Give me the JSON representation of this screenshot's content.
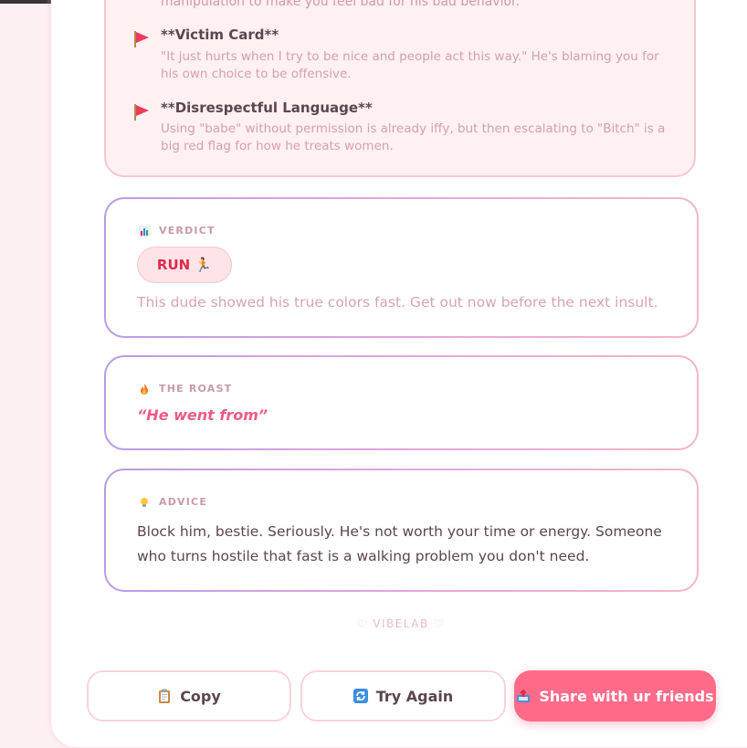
{
  "flags_section": {
    "cut_text": "manipulation to make you feel bad for his bad behavior.",
    "items": [
      {
        "title": "**Victim Card**",
        "description": "\"It just hurts when I try to be nice and people act this way.\" He's blaming you for his own choice to be offensive.",
        "icon": "red-flag-icon"
      },
      {
        "title": "**Disrespectful Language**",
        "description": "Using \"babe\" without permission is already iffy, but then escalating to \"Bitch\" is a big red flag for how he treats women.",
        "icon": "red-flag-icon"
      }
    ]
  },
  "verdict": {
    "label": "VERDICT",
    "icon": "bar-chart-icon",
    "pill": "RUN 🏃",
    "text": "This dude showed his true colors fast. Get out now before the next insult."
  },
  "roast": {
    "label": "THE ROAST",
    "icon": "fire-icon",
    "text": "“He went from”"
  },
  "advice": {
    "label": "ADVICE",
    "icon": "lightbulb-icon",
    "text": "Block him, bestie. Seriously. He's not worth your time or energy. Someone who turns hostile that fast is a walking problem you don't need."
  },
  "brand": "♡ VIBELAB ♡",
  "buttons": {
    "copy": "Copy",
    "try_again": "Try Again",
    "share": "Share with ur friends"
  },
  "colors": {
    "accent": "#ff6b89",
    "verdict_red": "#e0294b",
    "roast_pink": "#ef5b82"
  }
}
